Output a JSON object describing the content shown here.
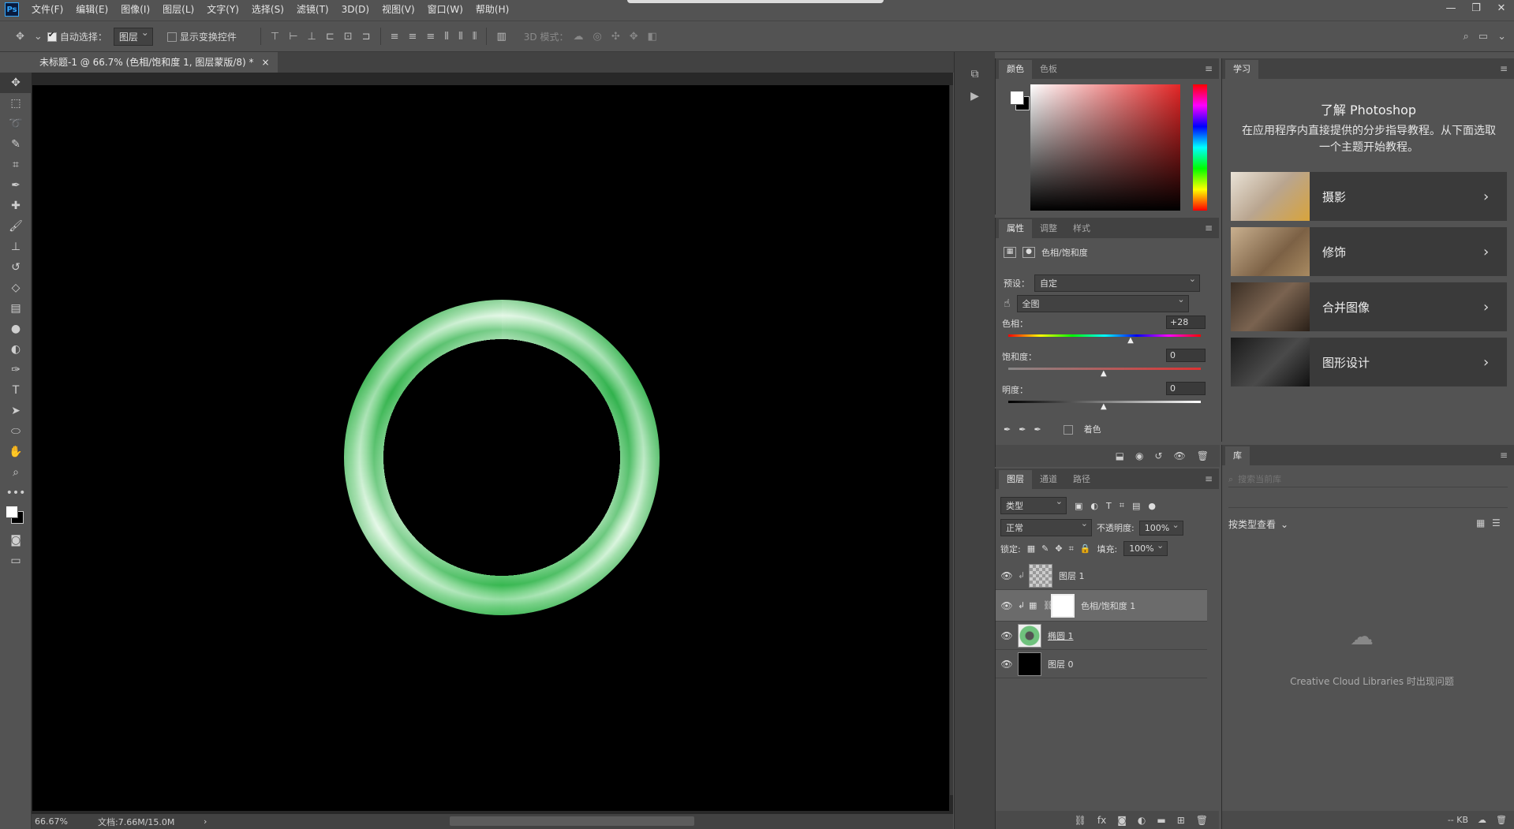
{
  "menubar": {
    "logo": "Ps",
    "items": [
      "文件(F)",
      "编辑(E)",
      "图像(I)",
      "图层(L)",
      "文字(Y)",
      "选择(S)",
      "滤镜(T)",
      "3D(D)",
      "视图(V)",
      "窗口(W)",
      "帮助(H)"
    ],
    "window_controls": [
      "—",
      "❐",
      "✕"
    ]
  },
  "options": {
    "auto_select_label": "自动选择：",
    "auto_select_value": "图层",
    "show_transform_label": "显示变换控件",
    "mode_3d_label": "3D 模式："
  },
  "document": {
    "tab_title": "未标题-1 @ 66.7% (色相/饱和度 1, 图层蒙版/8) *",
    "close": "×",
    "zoom": "66.67%",
    "doc_size": "文档:7.66M/15.0M"
  },
  "color_panel": {
    "tabs": [
      "颜色",
      "色板"
    ]
  },
  "properties_panel": {
    "tabs": [
      "属性",
      "调整",
      "样式"
    ],
    "title": "色相/饱和度",
    "preset_label": "预设：",
    "preset_value": "自定",
    "channel_value": "全图",
    "hue_label": "色相：",
    "hue_value": "+28",
    "hue_fraction": 0.64,
    "saturation_label": "饱和度：",
    "saturation_value": "0",
    "sat_fraction": 0.5,
    "lightness_label": "明度：",
    "lightness_value": "0",
    "light_fraction": 0.5,
    "colorize_label": "着色"
  },
  "layers_panel": {
    "tabs": [
      "图层",
      "通道",
      "路径"
    ],
    "filter_label": "类型",
    "blend_mode": "正常",
    "opacity_label": "不透明度:",
    "opacity_value": "100%",
    "lock_label": "锁定:",
    "fill_label": "填充:",
    "fill_value": "100%",
    "layers": [
      {
        "name": "图层 1"
      },
      {
        "name": "色相/饱和度 1"
      },
      {
        "name": "椭圆 1"
      },
      {
        "name": "图层 0"
      }
    ]
  },
  "learn_panel": {
    "tab": "学习",
    "heading": "了解 Photoshop",
    "description": "在应用程序内直接提供的分步指导教程。从下面选取一个主题开始教程。",
    "topics": [
      {
        "title": "摄影"
      },
      {
        "title": "修饰"
      },
      {
        "title": "合并图像"
      },
      {
        "title": "图形设计"
      }
    ]
  },
  "library_panel": {
    "tab": "库",
    "search_placeholder": "搜索当前库",
    "view_by_label": "按类型查看",
    "cc_message": "Creative Cloud Libraries 时出现问题",
    "size_label": "-- KB"
  },
  "colors": {
    "canvas": "#000000",
    "jade": "#5cc06e",
    "ui_bg": "#535353",
    "dark": "#424242"
  }
}
